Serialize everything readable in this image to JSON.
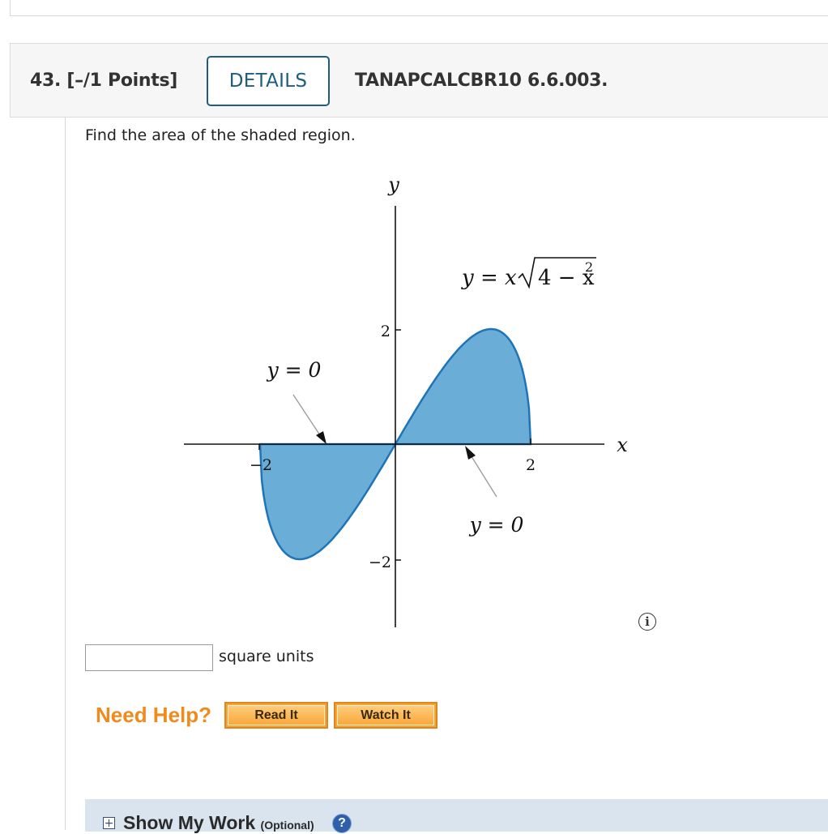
{
  "question": {
    "number_points": "43.  [–/1 Points]",
    "details_label": "DETAILS",
    "code": "TANAPCALCBR10 6.6.003.",
    "prompt": "Find the area of the shaded region."
  },
  "graph": {
    "y_axis_label": "y",
    "x_axis_label": "x",
    "curve_eq_lhs": "y = x",
    "curve_eq_radicand": "4 − x",
    "curve_eq_exponent": "2",
    "label_y0_left": "y = 0",
    "label_y0_right": "y = 0",
    "tick_y_pos": "2",
    "tick_y_neg": "−2",
    "tick_x_pos": "2",
    "tick_x_neg": "−2",
    "fill_color": "#6aaed8",
    "stroke_color": "#1f74b8"
  },
  "answer": {
    "value": "",
    "units": "square units"
  },
  "help": {
    "label": "Need Help?",
    "read_it": "Read It",
    "watch_it": "Watch It"
  },
  "work": {
    "title": "Show My Work",
    "optional": "(Optional)",
    "help_glyph": "?",
    "expand_glyph": "+"
  },
  "icons": {
    "info": "info-icon",
    "help": "question-icon",
    "expand": "plus-icon"
  }
}
